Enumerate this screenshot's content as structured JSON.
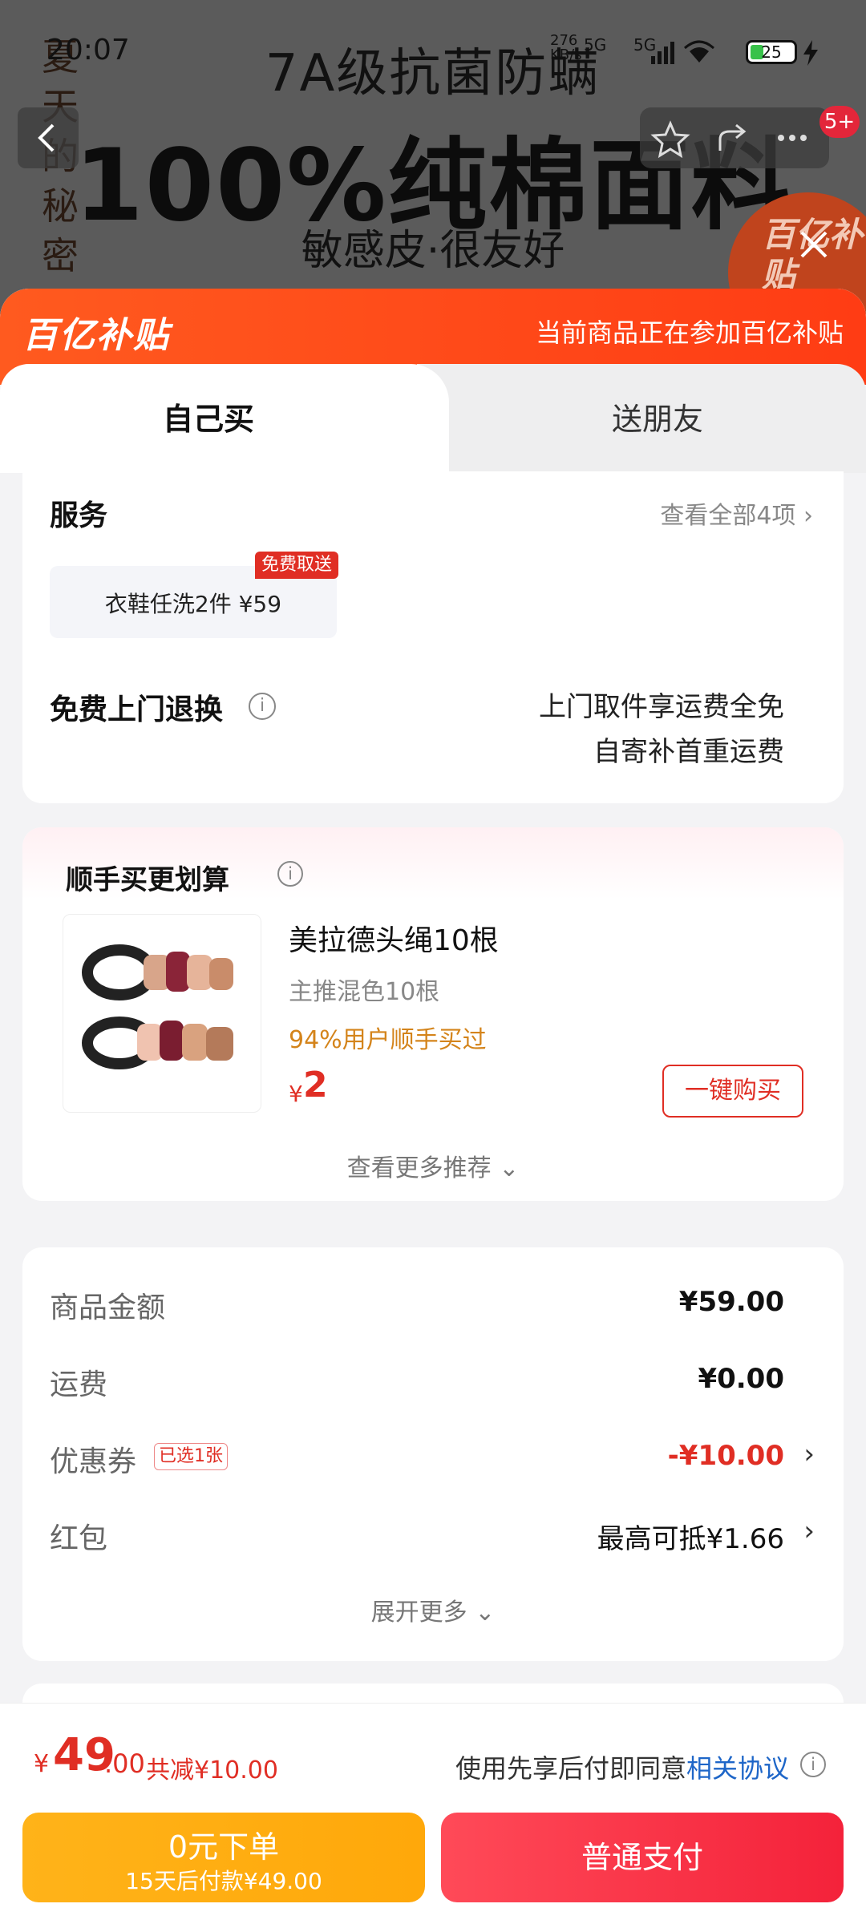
{
  "status": {
    "time": "20:07",
    "net_speed": "276\nKB/s",
    "signal1": "5G",
    "signal2": "5G",
    "battery": "25"
  },
  "background": {
    "side_text": "夏天的秘密",
    "line1": "7A级抗菌防螨",
    "line2": "100%纯棉面料",
    "line3": "敏感皮·很友好",
    "seal": "百亿补贴",
    "badge": "5+"
  },
  "banner": {
    "logo": "百亿补贴",
    "note": "当前商品正在参加百亿补贴"
  },
  "tabs": [
    {
      "label": "自己买"
    },
    {
      "label": "送朋友"
    }
  ],
  "services": {
    "title": "服务",
    "view_all": "查看全部4项 ›",
    "chip_label": "衣鞋任洗2件  ¥59",
    "chip_badge": "免费取送",
    "return_title": "免费上门退换",
    "return_line1": "上门取件享运费全免",
    "return_line2": "自寄补首重运费"
  },
  "upsell": {
    "title": "顺手买更划算",
    "item_name": "美拉德头绳10根",
    "item_spec": "主推混色10根",
    "item_stat": "94%用户顺手买过",
    "price_symbol": "¥",
    "price": "2",
    "buy_button": "一键购买",
    "more": "查看更多推荐 ⌄"
  },
  "summary": {
    "goods_label": "商品金额",
    "goods_value": "¥59.00",
    "shipping_label": "运费",
    "shipping_value": "¥0.00",
    "coupon_label": "优惠券",
    "coupon_tag": "已选1张",
    "coupon_value": "-¥10.00",
    "redpacket_label": "红包",
    "redpacket_value": "最高可抵¥1.66",
    "expand": "展开更多 ⌄"
  },
  "bottom": {
    "symbol": "¥",
    "amount_int": "49",
    "amount_dec": ".00",
    "saved": "共减¥10.00",
    "agree_text": "使用先享后付即同意",
    "agree_link": "相关协议",
    "later_label": "0元下单",
    "later_sub": "15天后付款¥49.00",
    "pay_label": "普通支付"
  },
  "colors": {
    "accent_red": "#e02e24",
    "banner_orange": "#ff5a1f",
    "later_yellow": "#ffb319",
    "pay_red": "#f4223a",
    "link_blue": "#1e66c8"
  }
}
